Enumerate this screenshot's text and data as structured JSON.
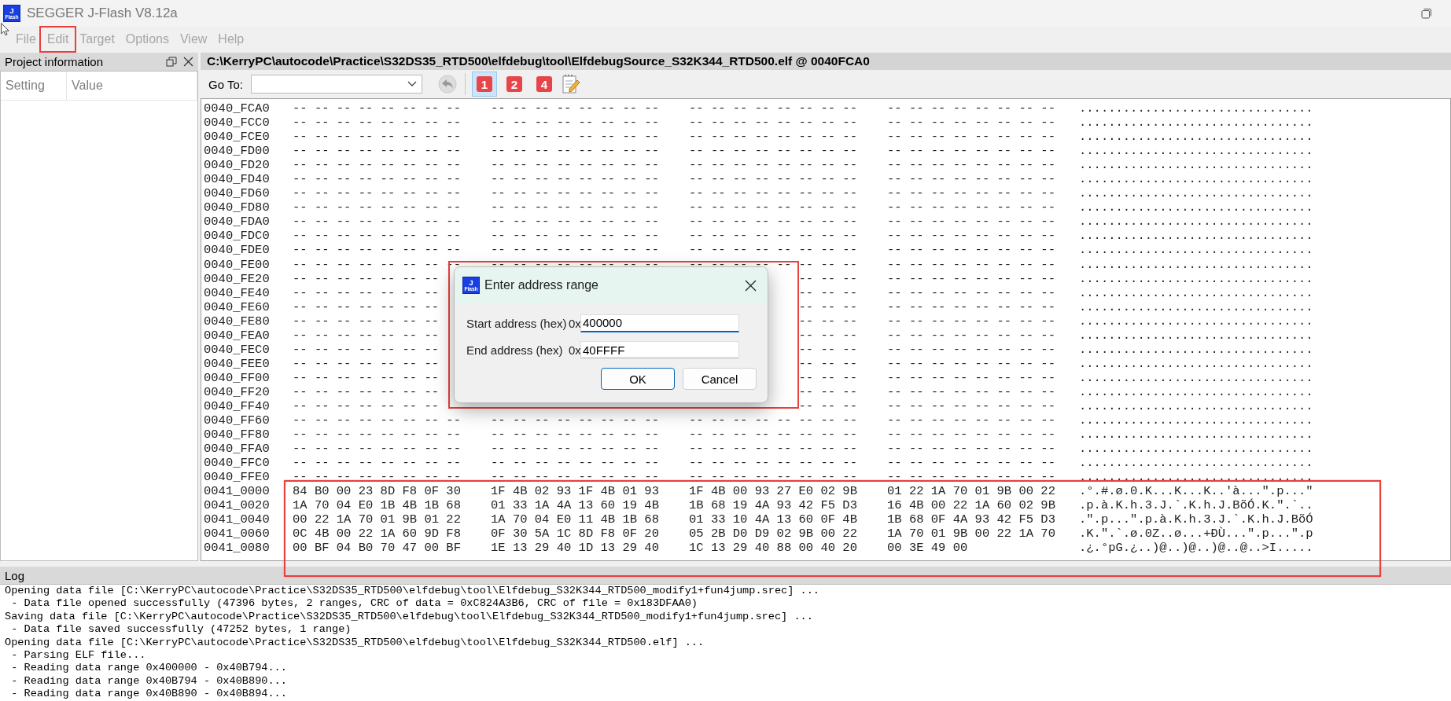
{
  "window": {
    "title": "SEGGER J-Flash V8.12a",
    "app_icon": {
      "top": "J",
      "bottom": "Flash"
    }
  },
  "menu": [
    {
      "label": "File",
      "highlighted": false
    },
    {
      "label": "Edit",
      "highlighted": true
    },
    {
      "label": "Target",
      "highlighted": false
    },
    {
      "label": "Options",
      "highlighted": false
    },
    {
      "label": "View",
      "highlighted": false
    },
    {
      "label": "Help",
      "highlighted": false
    }
  ],
  "project_panel": {
    "title": "Project information",
    "columns": [
      "Setting",
      "Value"
    ]
  },
  "data_window": {
    "title": "C:\\KerryPC\\autocode\\Practice\\S32DS35_RTD500\\elfdebug\\tool\\ElfdebugSource_S32K344_RTD500.elf @ 0040FCA0",
    "goto_label": "Go To:",
    "toolbar": [
      {
        "label": "1",
        "selected": true
      },
      {
        "label": "2",
        "selected": false
      },
      {
        "label": "4",
        "selected": false
      }
    ],
    "rows": [
      {
        "address": "0040_FCA0",
        "groups": [
          "-- -- -- -- -- -- -- --",
          "-- -- -- -- -- -- -- --",
          "-- -- -- -- -- -- -- --",
          "-- -- -- -- -- -- -- --"
        ],
        "ascii": "................................",
        "highlighted": false
      },
      {
        "address": "0040_FCC0",
        "groups": [
          "-- -- -- -- -- -- -- --",
          "-- -- -- -- -- -- -- --",
          "-- -- -- -- -- -- -- --",
          "-- -- -- -- -- -- -- --"
        ],
        "ascii": "................................",
        "highlighted": false
      },
      {
        "address": "0040_FCE0",
        "groups": [
          "-- -- -- -- -- -- -- --",
          "-- -- -- -- -- -- -- --",
          "-- -- -- -- -- -- -- --",
          "-- -- -- -- -- -- -- --"
        ],
        "ascii": "................................",
        "highlighted": false
      },
      {
        "address": "0040_FD00",
        "groups": [
          "-- -- -- -- -- -- -- --",
          "-- -- -- -- -- -- -- --",
          "-- -- -- -- -- -- -- --",
          "-- -- -- -- -- -- -- --"
        ],
        "ascii": "................................",
        "highlighted": false
      },
      {
        "address": "0040_FD20",
        "groups": [
          "-- -- -- -- -- -- -- --",
          "-- -- -- -- -- -- -- --",
          "-- -- -- -- -- -- -- --",
          "-- -- -- -- -- -- -- --"
        ],
        "ascii": "................................",
        "highlighted": false
      },
      {
        "address": "0040_FD40",
        "groups": [
          "-- -- -- -- -- -- -- --",
          "-- -- -- -- -- -- -- --",
          "-- -- -- -- -- -- -- --",
          "-- -- -- -- -- -- -- --"
        ],
        "ascii": "................................",
        "highlighted": false
      },
      {
        "address": "0040_FD60",
        "groups": [
          "-- -- -- -- -- -- -- --",
          "-- -- -- -- -- -- -- --",
          "-- -- -- -- -- -- -- --",
          "-- -- -- -- -- -- -- --"
        ],
        "ascii": "................................",
        "highlighted": false
      },
      {
        "address": "0040_FD80",
        "groups": [
          "-- -- -- -- -- -- -- --",
          "-- -- -- -- -- -- -- --",
          "-- -- -- -- -- -- -- --",
          "-- -- -- -- -- -- -- --"
        ],
        "ascii": "................................",
        "highlighted": false
      },
      {
        "address": "0040_FDA0",
        "groups": [
          "-- -- -- -- -- -- -- --",
          "-- -- -- -- -- -- -- --",
          "-- -- -- -- -- -- -- --",
          "-- -- -- -- -- -- -- --"
        ],
        "ascii": "................................",
        "highlighted": false
      },
      {
        "address": "0040_FDC0",
        "groups": [
          "-- -- -- -- -- -- -- --",
          "-- -- -- -- -- -- -- --",
          "-- -- -- -- -- -- -- --",
          "-- -- -- -- -- -- -- --"
        ],
        "ascii": "................................",
        "highlighted": false
      },
      {
        "address": "0040_FDE0",
        "groups": [
          "-- -- -- -- -- -- -- --",
          "-- -- -- -- -- -- -- --",
          "-- -- -- -- -- -- -- --",
          "-- -- -- -- -- -- -- --"
        ],
        "ascii": "................................",
        "highlighted": false
      },
      {
        "address": "0040_FE00",
        "groups": [
          "-- -- -- -- -- -- -- --",
          "-- -- -- -- -- -- -- --",
          "-- -- -- -- -- -- -- --",
          "-- -- -- -- -- -- -- --"
        ],
        "ascii": "................................",
        "highlighted": false
      },
      {
        "address": "0040_FE20",
        "covered": true,
        "groups": [
          "-- -- -- -- -- -- --",
          "-- -- --",
          "-- -- -- -- -- -- -- --"
        ],
        "ascii": "................................",
        "highlighted": false
      },
      {
        "address": "0040_FE40",
        "covered": true,
        "groups": [
          "-- -- -- -- -- -- --",
          "-- -- --",
          "-- -- -- -- -- -- -- --"
        ],
        "ascii": "................................",
        "highlighted": false
      },
      {
        "address": "0040_FE60",
        "covered": true,
        "groups": [
          "-- -- -- -- -- -- --",
          "-- -- --",
          "-- -- -- -- -- -- -- --"
        ],
        "ascii": "................................",
        "highlighted": false
      },
      {
        "address": "0040_FE80",
        "covered": true,
        "groups": [
          "-- -- -- -- -- -- --",
          "-- -- --",
          "-- -- -- -- -- -- -- --"
        ],
        "ascii": "................................",
        "highlighted": false
      },
      {
        "address": "0040_FEA0",
        "covered": true,
        "groups": [
          "-- -- -- -- -- -- --",
          "-- -- --",
          "-- -- -- -- -- -- -- --"
        ],
        "ascii": "................................",
        "highlighted": false
      },
      {
        "address": "0040_FEC0",
        "covered": true,
        "groups": [
          "-- -- -- -- -- -- --",
          "-- -- --",
          "-- -- -- -- -- -- -- --"
        ],
        "ascii": "................................",
        "highlighted": false
      },
      {
        "address": "0040_FEE0",
        "covered": true,
        "groups": [
          "-- -- -- -- -- -- --",
          "-- -- --",
          "-- -- -- -- -- -- -- --"
        ],
        "ascii": "................................",
        "highlighted": false
      },
      {
        "address": "0040_FF00",
        "covered": true,
        "groups": [
          "-- -- -- -- -- -- --",
          "-- -- --",
          "-- -- -- -- -- -- -- --"
        ],
        "ascii": "................................",
        "highlighted": false
      },
      {
        "address": "0040_FF20",
        "covered": true,
        "groups": [
          "-- -- -- -- -- -- --",
          "-- -- --",
          "-- -- -- -- -- -- -- --"
        ],
        "ascii": "................................",
        "highlighted": false
      },
      {
        "address": "0040_FF40",
        "covered": true,
        "groups": [
          "-- -- -- -- -- -- --",
          "-- -- --",
          "-- -- -- -- -- -- -- --"
        ],
        "ascii": "................................",
        "highlighted": false
      },
      {
        "address": "0040_FF60",
        "groups": [
          "-- -- -- -- -- -- -- --",
          "-- -- -- -- -- -- -- --",
          "-- -- -- -- -- -- -- --",
          "-- -- -- -- -- -- -- --"
        ],
        "ascii": "................................",
        "highlighted": false
      },
      {
        "address": "0040_FF80",
        "groups": [
          "-- -- -- -- -- -- -- --",
          "-- -- -- -- -- -- -- --",
          "-- -- -- -- -- -- -- --",
          "-- -- -- -- -- -- -- --"
        ],
        "ascii": "................................",
        "highlighted": false
      },
      {
        "address": "0040_FFA0",
        "groups": [
          "-- -- -- -- -- -- -- --",
          "-- -- -- -- -- -- -- --",
          "-- -- -- -- -- -- -- --",
          "-- -- -- -- -- -- -- --"
        ],
        "ascii": "................................",
        "highlighted": false
      },
      {
        "address": "0040_FFC0",
        "groups": [
          "-- -- -- -- -- -- -- --",
          "-- -- -- -- -- -- -- --",
          "-- -- -- -- -- -- -- --",
          "-- -- -- -- -- -- -- --"
        ],
        "ascii": "................................",
        "highlighted": false
      },
      {
        "address": "0040_FFE0",
        "groups": [
          "-- -- -- -- -- -- -- --",
          "-- -- -- -- -- -- -- --",
          "-- -- -- -- -- -- -- --",
          "-- -- -- -- -- -- -- --"
        ],
        "ascii": "................................",
        "highlighted": false
      },
      {
        "address": "0041_0000",
        "groups": [
          "84 B0 00 23 8D F8 0F 30",
          "1F 4B 02 93 1F 4B 01 93",
          "1F 4B 00 93 27 E0 02 9B",
          "01 22 1A 70 01 9B 00 22"
        ],
        "ascii": ".°.#.ø.0.K...K...K..'à...\".p...\"",
        "highlighted": true
      },
      {
        "address": "0041_0020",
        "groups": [
          "1A 70 04 E0 1B 4B 1B 68",
          "01 33 1A 4A 13 60 19 4B",
          "1B 68 19 4A 93 42 F5 D3",
          "16 4B 00 22 1A 60 02 9B"
        ],
        "ascii": ".p.à.K.h.3.J.`.K.h.J.BõÓ.K.\".`..",
        "highlighted": true
      },
      {
        "address": "0041_0040",
        "groups": [
          "00 22 1A 70 01 9B 01 22",
          "1A 70 04 E0 11 4B 1B 68",
          "01 33 10 4A 13 60 0F 4B",
          "1B 68 0F 4A 93 42 F5 D3"
        ],
        "ascii": ".\".p...\".p.à.K.h.3.J.`.K.h.J.BõÓ",
        "highlighted": true
      },
      {
        "address": "0041_0060",
        "groups": [
          "0C 4B 00 22 1A 60 9D F8",
          "0F 30 5A 1C 8D F8 0F 20",
          "05 2B D0 D9 02 9B 00 22",
          "1A 70 01 9B 00 22 1A 70"
        ],
        "ascii": ".K.\".`.ø.0Z..ø...+ÐÙ...\".p...\".p",
        "highlighted": true
      },
      {
        "address": "0041_0080",
        "groups": [
          "00 BF 04 B0 70 47 00 BF",
          "1E 13 29 40 1D 13 29 40",
          "1C 13 29 40 88 00 40 20",
          "00 3E 49 00"
        ],
        "ascii": ".¿.°pG.¿..)@..)@..)@..@..>I.....",
        "highlighted": true
      }
    ]
  },
  "dialog": {
    "title": "Enter address range",
    "highlighted": true,
    "icon": {
      "top": "J",
      "bottom": "Flash"
    },
    "fields": [
      {
        "label": "Start address (hex)",
        "prefix": "0x",
        "value": "400000",
        "focused": true
      },
      {
        "label": "End address (hex)",
        "prefix": "0x",
        "value": "40FFFF",
        "focused": false
      }
    ],
    "buttons": [
      {
        "label": "OK",
        "default": true
      },
      {
        "label": "Cancel",
        "default": false
      }
    ]
  },
  "log": {
    "title": "Log",
    "lines": [
      "Opening data file [C:\\KerryPC\\autocode\\Practice\\S32DS35_RTD500\\elfdebug\\tool\\Elfdebug_S32K344_RTD500_modify1+fun4jump.srec] ...",
      " - Data file opened successfully (47396 bytes, 2 ranges, CRC of data = 0xC824A3B6, CRC of file = 0x183DFAA0)",
      "Saving data file [C:\\KerryPC\\autocode\\Practice\\S32DS35_RTD500\\elfdebug\\tool\\Elfdebug_S32K344_RTD500_modify1+fun4jump.srec] ...",
      " - Data file saved successfully (47252 bytes, 1 range)",
      "Opening data file [C:\\KerryPC\\autocode\\Practice\\S32DS35_RTD500\\elfdebug\\tool\\Elfdebug_S32K344_RTD500.elf] ...",
      " - Parsing ELF file...",
      " - Reading data range 0x400000 - 0x40B794...",
      " - Reading data range 0x40B794 - 0x40B890...",
      " - Reading data range 0x40B890 - 0x40B894..."
    ]
  }
}
